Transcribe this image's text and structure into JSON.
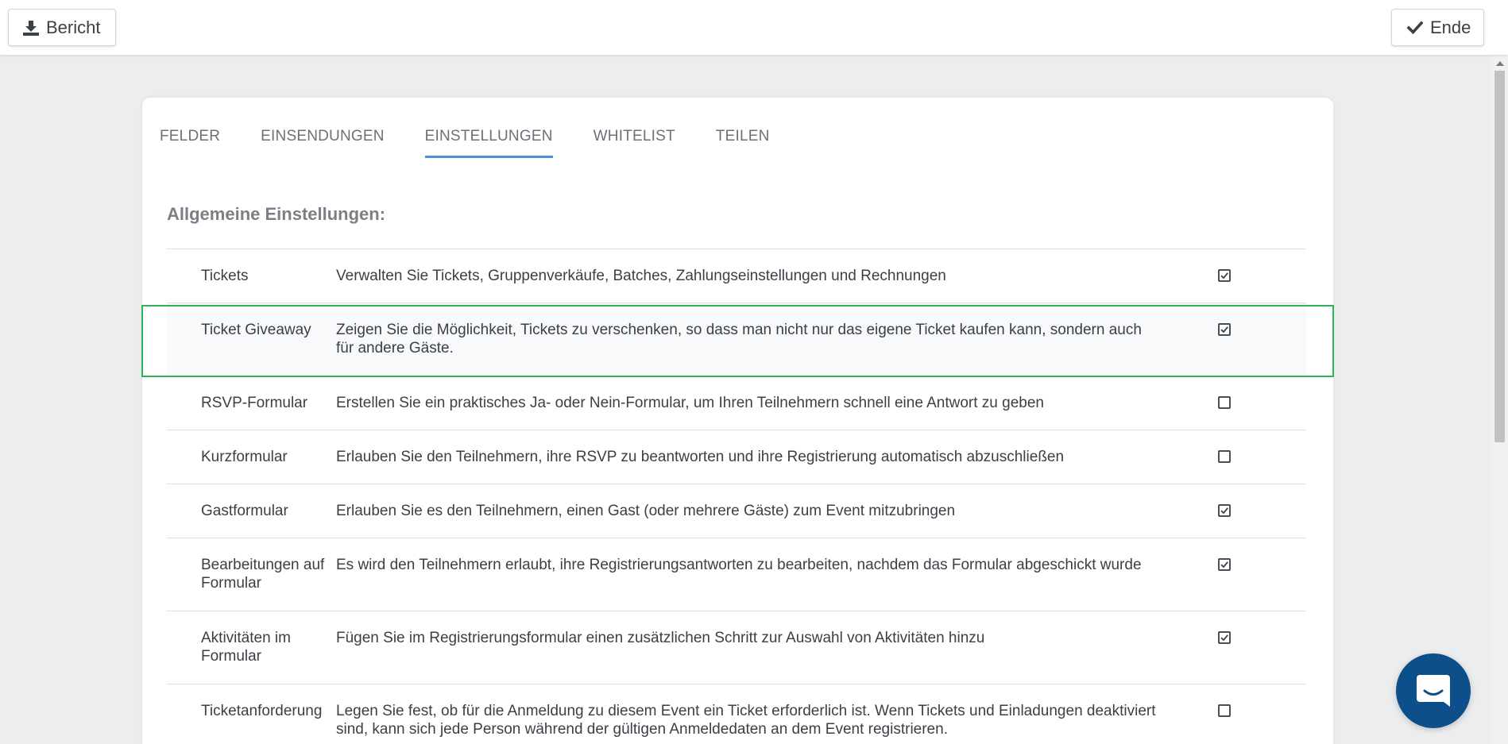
{
  "toolbar": {
    "report_label": "Bericht",
    "end_label": "Ende"
  },
  "tabs": [
    {
      "label": "FELDER",
      "active": false
    },
    {
      "label": "EINSENDUNGEN",
      "active": false
    },
    {
      "label": "EINSTELLUNGEN",
      "active": true
    },
    {
      "label": "WHITELIST",
      "active": false
    },
    {
      "label": "TEILEN",
      "active": false
    }
  ],
  "section": {
    "title": "Allgemeine Einstellungen:"
  },
  "settings": [
    {
      "name": "Tickets",
      "description": "Verwalten Sie Tickets, Gruppenverkäufe, Batches, Zahlungseinstellungen und Rechnungen",
      "checked": true
    },
    {
      "name": "Ticket Giveaway",
      "description": "Zeigen Sie die Möglichkeit, Tickets zu verschenken, so dass man nicht nur das eigene Ticket kaufen kann, sondern auch für andere Gäste.",
      "checked": true
    },
    {
      "name": "RSVP-Formular",
      "description": "Erstellen Sie ein praktisches Ja- oder Nein-Formular, um Ihren Teilnehmern schnell eine Antwort zu geben",
      "checked": false
    },
    {
      "name": "Kurzformular",
      "description": "Erlauben Sie den Teilnehmern, ihre RSVP zu beantworten und ihre Registrierung automatisch abzuschließen",
      "checked": false
    },
    {
      "name": "Gastformular",
      "description": "Erlauben Sie es den Teilnehmern, einen Gast (oder mehrere Gäste) zum Event mitzubringen",
      "checked": true
    },
    {
      "name": "Bearbeitungen auf Formular",
      "description": "Es wird den Teilnehmern erlaubt, ihre Registrierungsantworten zu bearbeiten, nachdem das Formular abgeschickt wurde",
      "checked": true
    },
    {
      "name": "Aktivitäten im Formular",
      "description": "Fügen Sie im Registrierungsformular einen zusätzlichen Schritt zur Auswahl von Aktivitäten hinzu",
      "checked": true
    },
    {
      "name": "Ticketanforderung",
      "description": "Legen Sie fest, ob für die Anmeldung zu diesem Event ein Ticket erforderlich ist. Wenn Tickets und Einladungen deaktiviert sind, kann sich jede Person während der gültigen Anmeldedaten an dem Event registrieren.",
      "checked": false
    }
  ],
  "colors": {
    "accent": "#4a90d9",
    "highlight_border": "#2fb35a",
    "chat_bubble": "#0d4f8b"
  },
  "icons": {
    "report": "download-icon",
    "end": "checkmark-icon",
    "chat": "chat-icon"
  }
}
